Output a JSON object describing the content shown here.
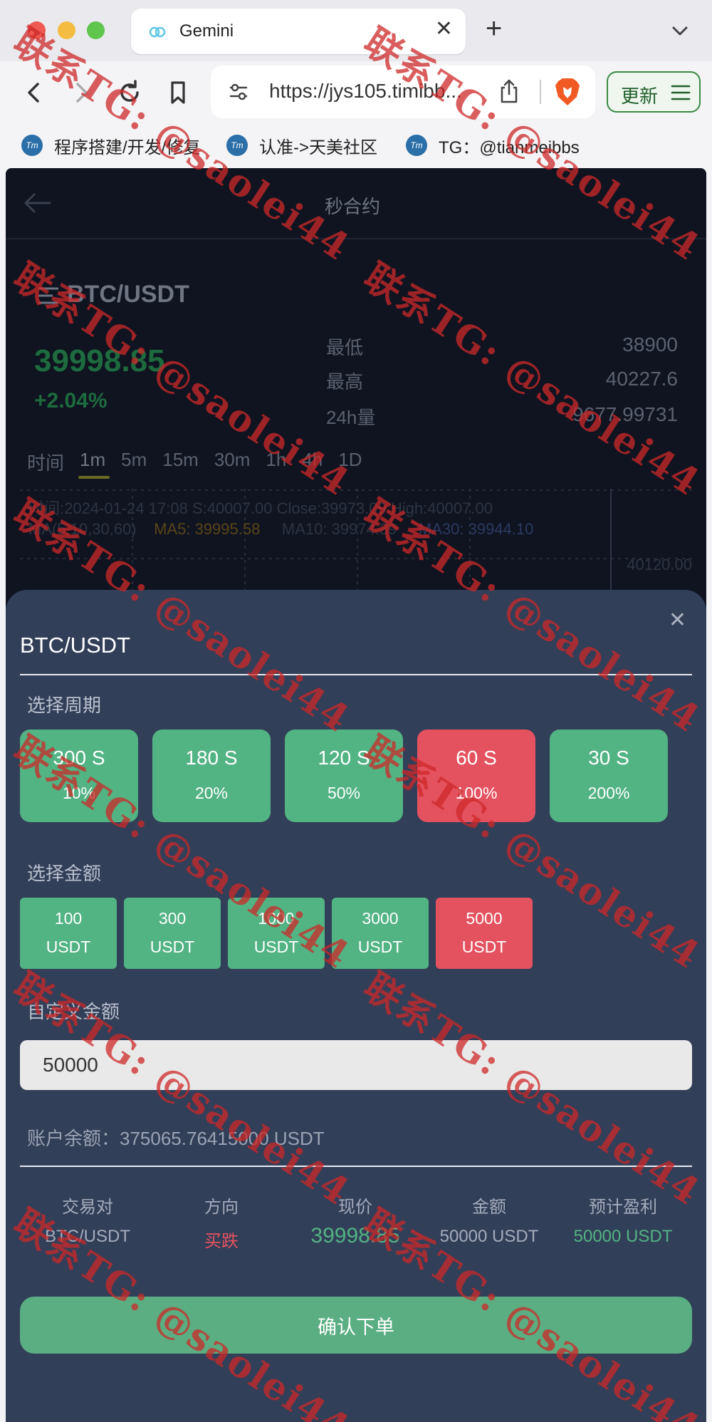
{
  "browser": {
    "tab_title": "Gemini",
    "url": "https://jys105.timibb...",
    "update_label": "更新",
    "bookmarks": [
      {
        "icon_text": "Tm",
        "label": "程序搭建/开发/修复"
      },
      {
        "icon_text": "Tm",
        "label": "认准->天美社区"
      },
      {
        "icon_text": "Tm",
        "label": "TG：@tianmeibbs"
      }
    ],
    "icons": [
      "back-icon",
      "forward-icon",
      "reload-icon",
      "bookmark-icon",
      "tune-icon",
      "share-icon",
      "brave-lion-icon",
      "hamburger-icon",
      "chevron-down-icon",
      "plus-icon",
      "close-icon"
    ]
  },
  "page": {
    "header_title": "秒合约",
    "pair": "BTC/USDT",
    "price": "39998.85",
    "change": "+2.04%",
    "stats": [
      {
        "label": "最低",
        "value": "38900"
      },
      {
        "label": "最高",
        "value": "40227.6"
      },
      {
        "label": "24h量",
        "value": "9677.99731"
      }
    ],
    "time_tabs": [
      "时间",
      "1m",
      "5m",
      "15m",
      "30m",
      "1h",
      "4h",
      "1D"
    ],
    "active_time_tab": "1m",
    "chart_info_line1": "时间:2024-01-24 17:08    S:40007.00    Close:39973.09    High:40007.00",
    "chart_info_ma": "MA(5,10,30,60)",
    "chart_info_ma5": "MA5: 39995.58",
    "chart_info_ma10": "MA10: 39974.39",
    "chart_info_ma30": "MA30: 39944.10",
    "chart_price_label": "40120.00"
  },
  "sheet": {
    "title": "BTC/USDT",
    "period_label": "选择周期",
    "periods": [
      {
        "duration": "300 S",
        "rate": "10%"
      },
      {
        "duration": "180 S",
        "rate": "20%"
      },
      {
        "duration": "120 S",
        "rate": "50%"
      },
      {
        "duration": "60 S",
        "rate": "100%"
      },
      {
        "duration": "30 S",
        "rate": "200%"
      }
    ],
    "active_period_index": 3,
    "amount_label": "选择金额",
    "amounts": [
      {
        "value": "100",
        "unit": "USDT"
      },
      {
        "value": "300",
        "unit": "USDT"
      },
      {
        "value": "1000",
        "unit": "USDT"
      },
      {
        "value": "3000",
        "unit": "USDT"
      },
      {
        "value": "5000",
        "unit": "USDT"
      }
    ],
    "active_amount_index": 4,
    "custom_label": "自定义金额",
    "custom_value": "50000",
    "balance": "账户余额：375065.76415000 USDT",
    "summary_headers": [
      "交易对",
      "方向",
      "现价",
      "金额",
      "预计盈利"
    ],
    "summary_values": [
      "BTC/USDT",
      "买跌",
      "39998.85",
      "50000 USDT",
      "50000 USDT"
    ],
    "confirm_label": "确认下单"
  },
  "watermark": "联系TG: @saolei44",
  "colors": {
    "green": "#52b383",
    "red": "#e4525f",
    "sheet_bg": "#323f58",
    "page_bg": "#0f1420"
  }
}
